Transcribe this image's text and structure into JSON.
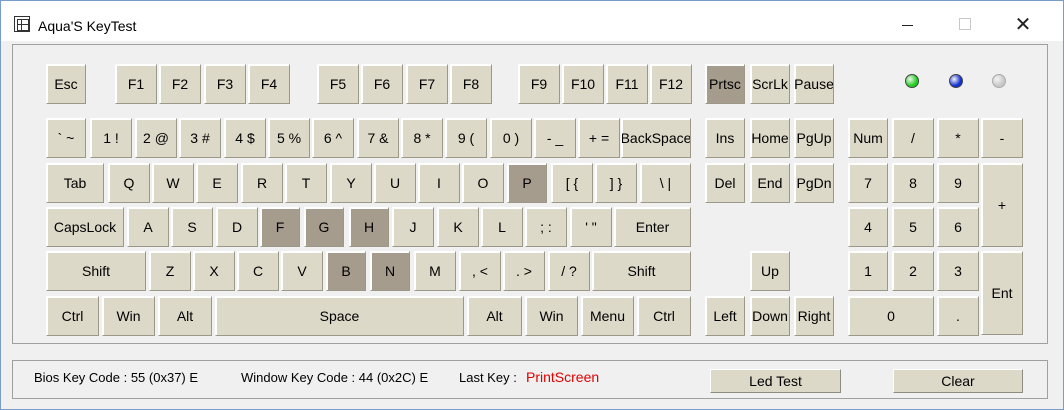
{
  "window": {
    "title": "Aqua'S KeyTest"
  },
  "keys": [
    {
      "id": "esc",
      "label": "Esc",
      "on": false
    },
    {
      "id": "f1",
      "label": "F1",
      "on": false
    },
    {
      "id": "f2",
      "label": "F2",
      "on": false
    },
    {
      "id": "f3",
      "label": "F3",
      "on": false
    },
    {
      "id": "f4",
      "label": "F4",
      "on": false
    },
    {
      "id": "f5",
      "label": "F5",
      "on": false
    },
    {
      "id": "f6",
      "label": "F6",
      "on": false
    },
    {
      "id": "f7",
      "label": "F7",
      "on": false
    },
    {
      "id": "f8",
      "label": "F8",
      "on": false
    },
    {
      "id": "f9",
      "label": "F9",
      "on": false
    },
    {
      "id": "f10",
      "label": "F10",
      "on": false
    },
    {
      "id": "f11",
      "label": "F11",
      "on": false
    },
    {
      "id": "f12",
      "label": "F12",
      "on": false
    },
    {
      "id": "prtsc",
      "label": "Prtsc",
      "on": true
    },
    {
      "id": "scrlk",
      "label": "ScrLk",
      "on": false
    },
    {
      "id": "pause",
      "label": "Pause",
      "on": false
    },
    {
      "id": "grave",
      "label": "` ~",
      "on": false
    },
    {
      "id": "1",
      "label": "1 !",
      "on": false
    },
    {
      "id": "2",
      "label": "2 @",
      "on": false
    },
    {
      "id": "3",
      "label": "3 #",
      "on": false
    },
    {
      "id": "4",
      "label": "4 $",
      "on": false
    },
    {
      "id": "5",
      "label": "5 %",
      "on": false
    },
    {
      "id": "6",
      "label": "6 ^",
      "on": false
    },
    {
      "id": "7",
      "label": "7 &",
      "on": false
    },
    {
      "id": "8",
      "label": "8 *",
      "on": false
    },
    {
      "id": "9",
      "label": "9 (",
      "on": false
    },
    {
      "id": "0",
      "label": "0 )",
      "on": false
    },
    {
      "id": "minus",
      "label": "- _",
      "on": false
    },
    {
      "id": "equal",
      "label": "+ =",
      "on": false
    },
    {
      "id": "backspace",
      "label": "BackSpace",
      "on": false
    },
    {
      "id": "ins",
      "label": "Ins",
      "on": false
    },
    {
      "id": "home",
      "label": "Home",
      "on": false
    },
    {
      "id": "pgup",
      "label": "PgUp",
      "on": false
    },
    {
      "id": "num",
      "label": "Num",
      "on": false
    },
    {
      "id": "kp-slash",
      "label": "/",
      "on": false
    },
    {
      "id": "kp-star",
      "label": "*",
      "on": false
    },
    {
      "id": "kp-minus",
      "label": "-",
      "on": false
    },
    {
      "id": "tab",
      "label": "Tab",
      "on": false
    },
    {
      "id": "q",
      "label": "Q",
      "on": false
    },
    {
      "id": "w",
      "label": "W",
      "on": false
    },
    {
      "id": "e",
      "label": "E",
      "on": false
    },
    {
      "id": "r",
      "label": "R",
      "on": false
    },
    {
      "id": "t",
      "label": "T",
      "on": false
    },
    {
      "id": "y",
      "label": "Y",
      "on": false
    },
    {
      "id": "u",
      "label": "U",
      "on": false
    },
    {
      "id": "i",
      "label": "I",
      "on": false
    },
    {
      "id": "o",
      "label": "O",
      "on": false
    },
    {
      "id": "p",
      "label": "P",
      "on": true
    },
    {
      "id": "lbracket",
      "label": "[ {",
      "on": false
    },
    {
      "id": "rbracket",
      "label": "] }",
      "on": false
    },
    {
      "id": "backslash",
      "label": "\\ |",
      "on": false
    },
    {
      "id": "del",
      "label": "Del",
      "on": false
    },
    {
      "id": "end",
      "label": "End",
      "on": false
    },
    {
      "id": "pgdn",
      "label": "PgDn",
      "on": false
    },
    {
      "id": "kp7",
      "label": "7",
      "on": false
    },
    {
      "id": "kp8",
      "label": "8",
      "on": false
    },
    {
      "id": "kp9",
      "label": "9",
      "on": false
    },
    {
      "id": "kp-plus",
      "label": "+",
      "on": false
    },
    {
      "id": "capslock",
      "label": "CapsLock",
      "on": false
    },
    {
      "id": "a",
      "label": "A",
      "on": false
    },
    {
      "id": "s",
      "label": "S",
      "on": false
    },
    {
      "id": "d",
      "label": "D",
      "on": false
    },
    {
      "id": "f",
      "label": "F",
      "on": true
    },
    {
      "id": "g",
      "label": "G",
      "on": true
    },
    {
      "id": "h",
      "label": "H",
      "on": true
    },
    {
      "id": "j",
      "label": "J",
      "on": false
    },
    {
      "id": "k",
      "label": "K",
      "on": false
    },
    {
      "id": "l",
      "label": "L",
      "on": false
    },
    {
      "id": "semicolon",
      "label": "; :",
      "on": false
    },
    {
      "id": "quote",
      "label": "' \"",
      "on": false
    },
    {
      "id": "enter",
      "label": "Enter",
      "on": false
    },
    {
      "id": "kp4",
      "label": "4",
      "on": false
    },
    {
      "id": "kp5",
      "label": "5",
      "on": false
    },
    {
      "id": "kp6",
      "label": "6",
      "on": false
    },
    {
      "id": "lshift",
      "label": "Shift",
      "on": false
    },
    {
      "id": "z",
      "label": "Z",
      "on": false
    },
    {
      "id": "x",
      "label": "X",
      "on": false
    },
    {
      "id": "c",
      "label": "C",
      "on": false
    },
    {
      "id": "v",
      "label": "V",
      "on": false
    },
    {
      "id": "b",
      "label": "B",
      "on": true
    },
    {
      "id": "n",
      "label": "N",
      "on": true
    },
    {
      "id": "m",
      "label": "M",
      "on": false
    },
    {
      "id": "comma",
      "label": ", <",
      "on": false
    },
    {
      "id": "period",
      "label": ". >",
      "on": false
    },
    {
      "id": "slash",
      "label": "/ ?",
      "on": false
    },
    {
      "id": "rshift",
      "label": "Shift",
      "on": false
    },
    {
      "id": "up",
      "label": "Up",
      "on": false
    },
    {
      "id": "kp1",
      "label": "1",
      "on": false
    },
    {
      "id": "kp2",
      "label": "2",
      "on": false
    },
    {
      "id": "kp3",
      "label": "3",
      "on": false
    },
    {
      "id": "kp-enter",
      "label": "Ent",
      "on": false
    },
    {
      "id": "lctrl",
      "label": "Ctrl",
      "on": false
    },
    {
      "id": "lwin",
      "label": "Win",
      "on": false
    },
    {
      "id": "lalt",
      "label": "Alt",
      "on": false
    },
    {
      "id": "space",
      "label": "Space",
      "on": false
    },
    {
      "id": "ralt",
      "label": "Alt",
      "on": false
    },
    {
      "id": "rwin",
      "label": "Win",
      "on": false
    },
    {
      "id": "menu",
      "label": "Menu",
      "on": false
    },
    {
      "id": "rctrl",
      "label": "Ctrl",
      "on": false
    },
    {
      "id": "left",
      "label": "Left",
      "on": false
    },
    {
      "id": "down",
      "label": "Down",
      "on": false
    },
    {
      "id": "right",
      "label": "Right",
      "on": false
    },
    {
      "id": "kp0",
      "label": "0",
      "on": false
    },
    {
      "id": "kp-dot",
      "label": ".",
      "on": false
    }
  ],
  "leds": [
    {
      "name": "num-lock-led",
      "color": "#1fcf1f"
    },
    {
      "name": "caps-lock-led",
      "color": "#1030d0"
    },
    {
      "name": "scroll-lock-led",
      "color": "#c8c8c8"
    }
  ],
  "status": {
    "bios_code": "Bios Key Code : 55 (0x37) E",
    "window_code": "Window Key Code : 44 (0x2C) E",
    "last_key_label": "Last Key :",
    "last_key_value": "PrintScreen",
    "led_test_label": "Led Test",
    "clear_label": "Clear"
  }
}
